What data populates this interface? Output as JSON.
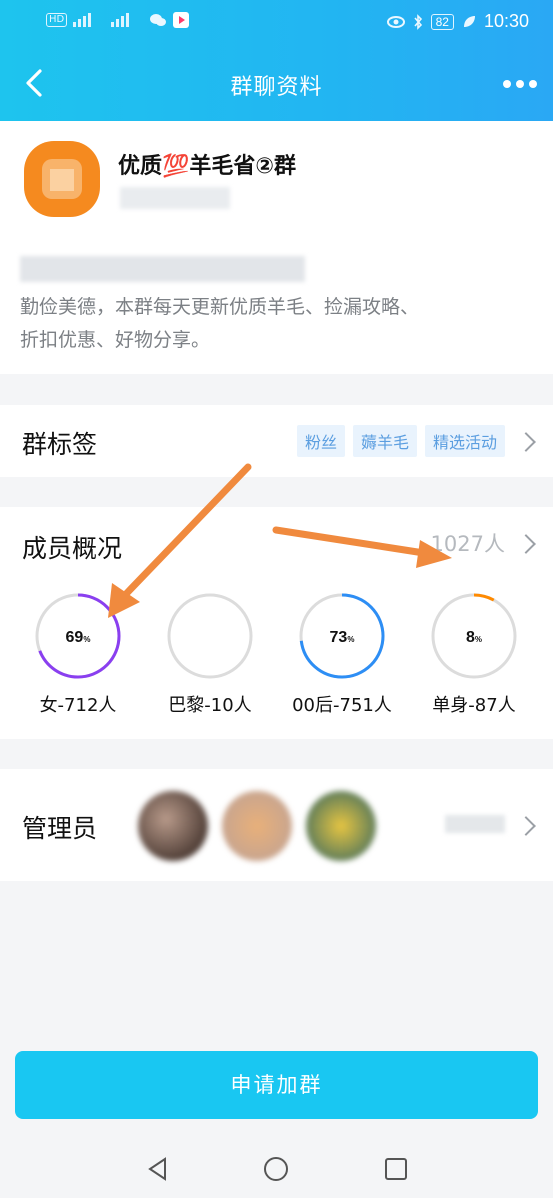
{
  "status_bar": {
    "time": "10:30",
    "battery": "82",
    "hd_label": "HD"
  },
  "header": {
    "title": "群聊资料"
  },
  "group": {
    "name": "优质💯羊毛省②群",
    "intro_line2": "勤俭美德，本群每天更新优质羊毛、捡漏攻略、",
    "intro_line3": "折扣优惠、好物分享。"
  },
  "tags_section": {
    "label": "群标签",
    "tags": [
      "粉丝",
      "薅羊毛",
      "精选活动"
    ]
  },
  "members": {
    "label": "成员概况",
    "count": "1027人",
    "stats": [
      {
        "percent_text": "69",
        "unit": "%",
        "label": "女-712人",
        "percent": 69,
        "color": "#8a3ff0"
      },
      {
        "percent_text": "",
        "unit": "",
        "label": "巴黎-10人",
        "percent": 0,
        "color": "#d9d9d9"
      },
      {
        "percent_text": "73",
        "unit": "%",
        "label": "00后-751人",
        "percent": 73,
        "color": "#2d8ef5"
      },
      {
        "percent_text": "8",
        "unit": "%",
        "label": "单身-87人",
        "percent": 8,
        "color": "#ff8a00"
      }
    ]
  },
  "admins": {
    "label": "管理员"
  },
  "cta": {
    "label": "申请加群"
  },
  "colors": {
    "accent": "#19c7f2",
    "annotation_arrow": "#f08a3e"
  }
}
